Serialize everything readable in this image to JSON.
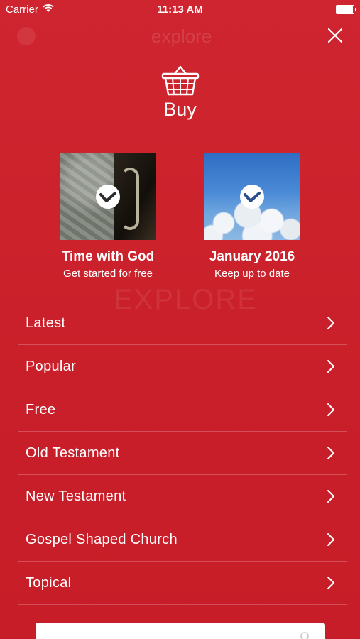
{
  "status_bar": {
    "carrier": "Carrier",
    "time": "11:13 AM"
  },
  "header": {
    "title_faded": "explore",
    "close_icon": "close-icon"
  },
  "buy": {
    "label": "Buy",
    "icon": "basket-icon"
  },
  "featured": [
    {
      "title": "Time with God",
      "subtitle": "Get started for free"
    },
    {
      "title": "January 2016",
      "subtitle": "Keep up to date"
    }
  ],
  "background_ghost": {
    "title": "EXPLORE"
  },
  "menu": {
    "items": [
      {
        "label": "Latest"
      },
      {
        "label": "Popular"
      },
      {
        "label": "Free"
      },
      {
        "label": "Old Testament"
      },
      {
        "label": "New Testament"
      },
      {
        "label": "Gospel Shaped Church"
      },
      {
        "label": "Topical"
      }
    ]
  },
  "search": {
    "placeholder": ""
  },
  "colors": {
    "background": "#cc222c",
    "text": "#ffffff",
    "divider": "rgba(255,255,255,0.22)"
  }
}
